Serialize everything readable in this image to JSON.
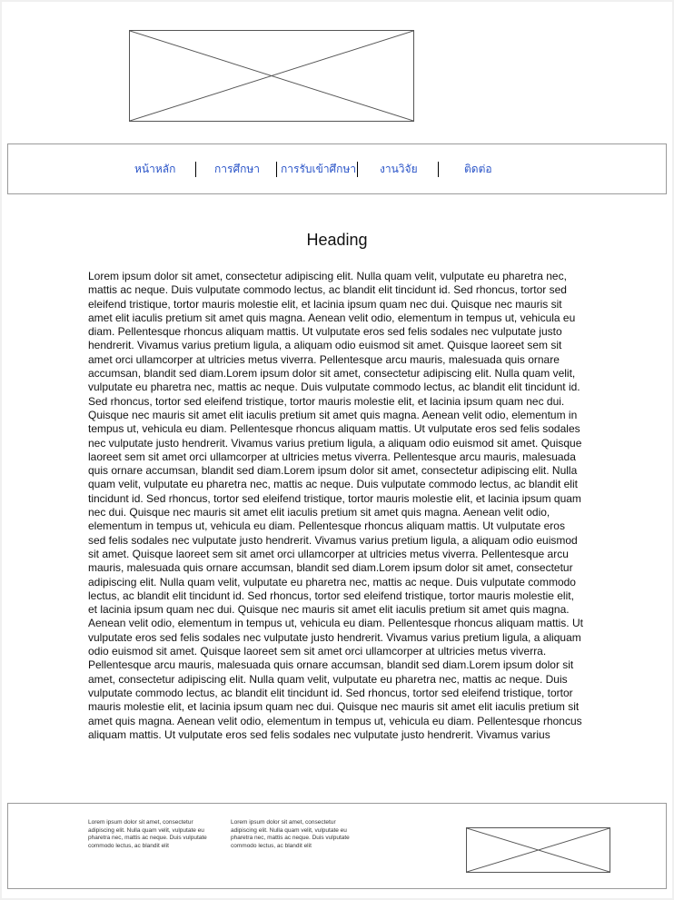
{
  "header": {
    "logo_icon": "image-placeholder-icon"
  },
  "nav": {
    "items": [
      {
        "label": "หน้าหลัก"
      },
      {
        "label": "การศึกษา"
      },
      {
        "label": "การรับเข้าศึกษา"
      },
      {
        "label": "งานวิจัย"
      },
      {
        "label": "ติดต่อ"
      }
    ],
    "link_color": "#2a54c8"
  },
  "main": {
    "heading": "Heading",
    "body": "Lorem ipsum dolor sit amet, consectetur adipiscing elit. Nulla quam velit, vulputate eu pharetra nec, mattis ac neque. Duis vulputate commodo lectus, ac blandit elit tincidunt id. Sed rhoncus, tortor sed eleifend tristique, tortor mauris molestie elit, et lacinia ipsum quam nec dui. Quisque nec mauris sit amet elit iaculis pretium sit amet quis magna. Aenean velit odio, elementum in tempus ut, vehicula eu diam. Pellentesque rhoncus aliquam mattis. Ut vulputate eros sed felis sodales nec vulputate justo hendrerit. Vivamus varius pretium ligula, a aliquam odio euismod sit amet. Quisque laoreet sem sit amet orci ullamcorper at ultricies metus viverra. Pellentesque arcu mauris, malesuada quis ornare accumsan, blandit sed diam.Lorem ipsum dolor sit amet, consectetur adipiscing elit. Nulla quam velit, vulputate eu pharetra nec, mattis ac neque. Duis vulputate commodo lectus, ac blandit elit tincidunt id. Sed rhoncus, tortor sed eleifend tristique, tortor mauris molestie elit, et lacinia ipsum quam nec dui. Quisque nec mauris sit amet elit iaculis pretium sit amet quis magna. Aenean velit odio, elementum in tempus ut, vehicula eu diam. Pellentesque rhoncus aliquam mattis. Ut vulputate eros sed felis sodales nec vulputate justo hendrerit. Vivamus varius pretium ligula, a aliquam odio euismod sit amet. Quisque laoreet sem sit amet orci ullamcorper at ultricies metus viverra. Pellentesque arcu mauris, malesuada quis ornare accumsan, blandit sed diam.Lorem ipsum dolor sit amet, consectetur adipiscing elit. Nulla quam velit, vulputate eu pharetra nec, mattis ac neque. Duis vulputate commodo lectus, ac blandit elit tincidunt id. Sed rhoncus, tortor sed eleifend tristique, tortor mauris molestie elit, et lacinia ipsum quam nec dui. Quisque nec mauris sit amet elit iaculis pretium sit amet quis magna. Aenean velit odio, elementum in tempus ut, vehicula eu diam. Pellentesque rhoncus aliquam mattis. Ut vulputate eros sed felis sodales nec vulputate justo hendrerit. Vivamus varius pretium ligula, a aliquam odio euismod sit amet. Quisque laoreet sem sit amet orci ullamcorper at ultricies metus viverra. Pellentesque arcu mauris, malesuada quis ornare accumsan, blandit sed diam.Lorem ipsum dolor sit amet, consectetur adipiscing elit. Nulla quam velit, vulputate eu pharetra nec, mattis ac neque. Duis vulputate commodo lectus, ac blandit elit tincidunt id. Sed rhoncus, tortor sed eleifend tristique, tortor mauris molestie elit, et lacinia ipsum quam nec dui. Quisque nec mauris sit amet elit iaculis pretium sit amet quis magna. Aenean velit odio, elementum in tempus ut, vehicula eu diam. Pellentesque rhoncus aliquam mattis. Ut vulputate eros sed felis sodales nec vulputate justo hendrerit. Vivamus varius pretium ligula, a aliquam odio euismod sit amet. Quisque laoreet sem sit amet orci ullamcorper at ultricies metus viverra. Pellentesque arcu mauris, malesuada quis ornare accumsan, blandit sed diam.Lorem ipsum dolor sit amet, consectetur adipiscing elit. Nulla quam velit, vulputate eu pharetra nec, mattis ac neque. Duis vulputate commodo lectus, ac blandit elit tincidunt id. Sed rhoncus, tortor sed eleifend tristique, tortor mauris molestie elit, et lacinia ipsum quam nec dui. Quisque nec mauris sit amet elit iaculis pretium sit amet quis magna. Aenean velit odio, elementum in tempus ut, vehicula eu diam. Pellentesque rhoncus aliquam mattis. Ut vulputate eros sed felis sodales nec vulputate justo hendrerit. Vivamus varius"
  },
  "footer": {
    "col1": "Lorem ipsum dolor sit amet, consectetur adipiscing elit. Nulla quam velit, vulputate eu pharetra nec, mattis ac neque. Duis vulputate commodo lectus, ac blandit elit",
    "col2": "Lorem ipsum dolor sit amet, consectetur adipiscing elit. Nulla quam velit, vulputate eu pharetra nec, mattis ac neque. Duis vulputate commodo lectus, ac blandit elit",
    "image_icon": "image-placeholder-icon"
  }
}
